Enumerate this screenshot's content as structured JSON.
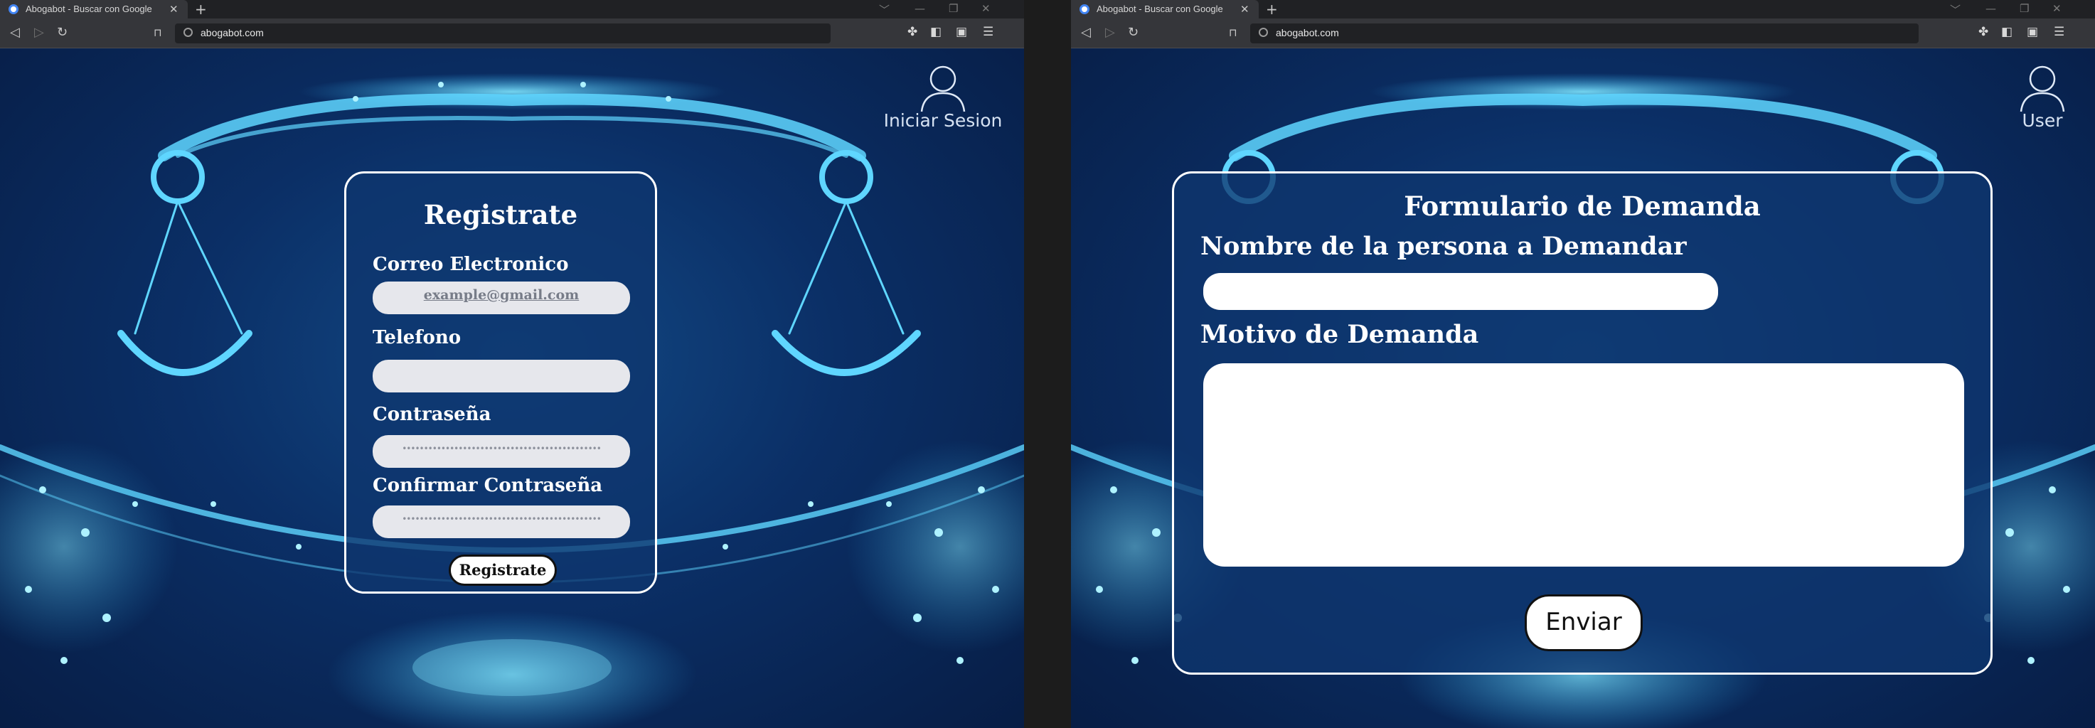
{
  "browser": {
    "tab_title": "Abogabot - Buscar con Google",
    "tab_close": "✕",
    "new_tab": "+",
    "url": "abogabot.com",
    "window_controls": [
      "﹀",
      "—",
      "❐",
      "✕"
    ],
    "nav": {
      "back": "◁",
      "forward": "▷",
      "reload": "↻"
    },
    "bookmark": "⊓",
    "toolbar_icons": [
      "✤",
      "◧",
      "▣",
      "☰"
    ]
  },
  "left_page": {
    "user_label": "Iniciar Sesion",
    "form": {
      "title": "Registrate",
      "email_label": "Correo Electronico",
      "email_placeholder": "example@gmail.com",
      "phone_label": "Telefono",
      "password_label": "Contraseña",
      "password_mask": "••••••••••••••••••••••••••••••••••••••••••••••",
      "confirm_label": "Confirmar Contraseña",
      "confirm_mask": "••••••••••••••••••••••••••••••••••••••••••••••",
      "submit_label": "Registrate"
    }
  },
  "right_page": {
    "user_label": "User",
    "form": {
      "title": "Formulario de Demanda",
      "name_label": "Nombre de la persona a Demandar",
      "reason_label": "Motivo de Demanda",
      "submit_label": "Enviar"
    }
  },
  "colors": {
    "page_background": "#0b2f66",
    "glow": "#5fd6ff",
    "panel_border": "#ffffff",
    "input_fill": "#e6e7ec"
  }
}
